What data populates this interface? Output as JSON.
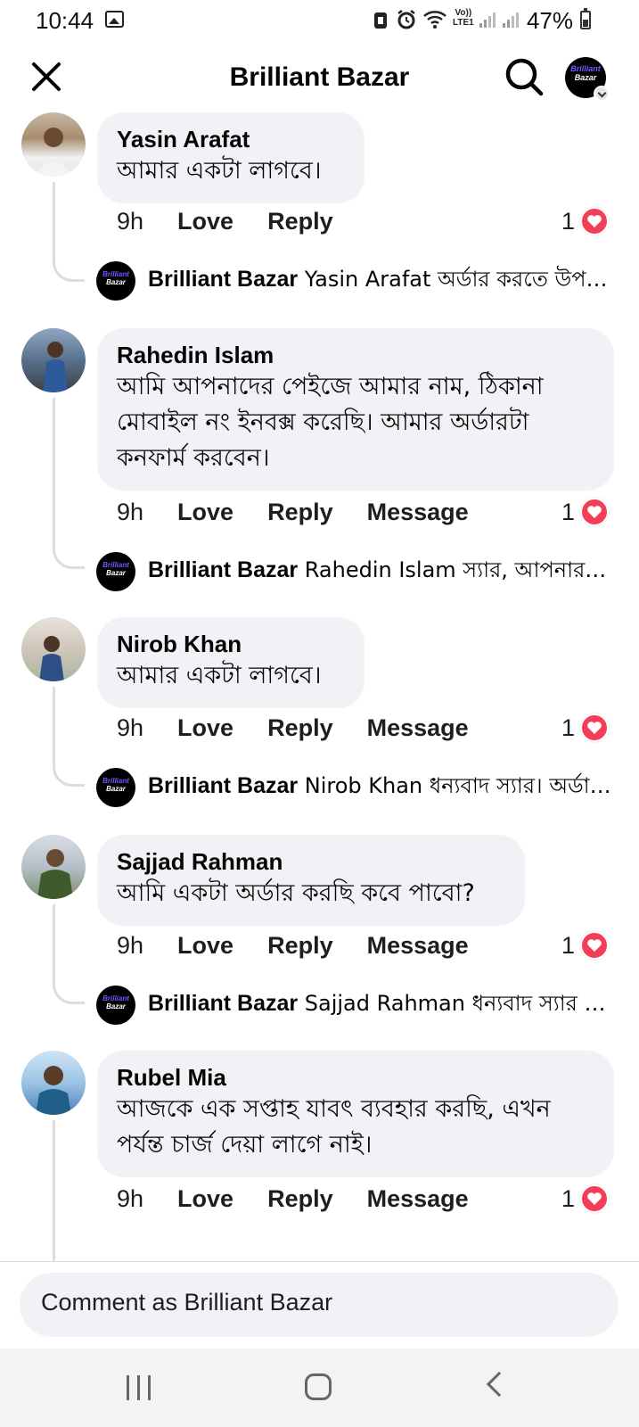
{
  "status_bar": {
    "time": "10:44",
    "battery": "47%",
    "network_label_top": "Vo))",
    "network_label_bottom": "LTE1"
  },
  "header": {
    "title": "Brilliant Bazar",
    "avatar_logo_line1": "Brilliant",
    "avatar_logo_line2": "Bazar"
  },
  "comments": [
    {
      "author": "Yasin Arafat",
      "text": "আমার একটা লাগবে।",
      "time": "9h",
      "actions": [
        "Love",
        "Reply"
      ],
      "reaction_count": "1",
      "reply": {
        "author": "Brilliant Bazar",
        "text": "Yasin Arafat অর্ডার করতে উপরে..."
      }
    },
    {
      "author": "Rahedin Islam",
      "text": "আমি আপনাদের পেইজে আমার নাম, ঠিকানা মোবাইল নং ইনবক্স করেছি। আমার অর্ডারটা কনফার্ম করবেন।",
      "time": "9h",
      "actions": [
        "Love",
        "Reply",
        "Message"
      ],
      "reaction_count": "1",
      "reply": {
        "author": "Brilliant Bazar",
        "text": "Rahedin Islam স্যার, আপনার অ..."
      }
    },
    {
      "author": "Nirob Khan",
      "text": "আমার একটা লাগবে।",
      "time": "9h",
      "actions": [
        "Love",
        "Reply",
        "Message"
      ],
      "reaction_count": "1",
      "reply": {
        "author": "Brilliant Bazar",
        "text": "Nirob Khan ধন্যবাদ স্যার। অর্ডার..."
      }
    },
    {
      "author": "Sajjad Rahman",
      "text": "আমি একটা অর্ডার করছি কবে পাবো?",
      "time": "9h",
      "actions": [
        "Love",
        "Reply",
        "Message"
      ],
      "reaction_count": "1",
      "reply": {
        "author": "Brilliant Bazar",
        "text": "Sajjad Rahman ধন্যবাদ স্যার আ..."
      }
    },
    {
      "author": "Rubel Mia",
      "text": "আজকে এক সপ্তাহ যাবৎ ব্যবহার করছি, এখন পর্যন্ত চার্জ দেয়া লাগে নাই।",
      "time": "9h",
      "actions": [
        "Love",
        "Reply",
        "Message"
      ],
      "reaction_count": "1"
    }
  ],
  "composer": {
    "placeholder": "Comment as Brilliant Bazar"
  },
  "colors": {
    "bubble": "#f0f2f5",
    "heart": "#f33e58",
    "thread_line": "#dadde1",
    "logo_purple": "#6e5bff"
  }
}
